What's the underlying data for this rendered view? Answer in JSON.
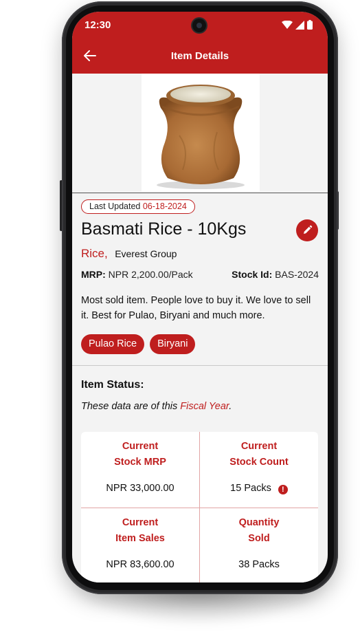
{
  "status_bar": {
    "time": "12:30",
    "icons": [
      "wifi-icon",
      "signal-icon",
      "battery-icon"
    ]
  },
  "app_bar": {
    "title": "Item Details",
    "back_icon": "arrow-left-icon"
  },
  "item": {
    "last_updated_label": "Last Updated",
    "last_updated_date": "06-18-2024",
    "name": "Basmati Rice - 10Kgs",
    "category": "Rice,",
    "brand": "Everest Group",
    "mrp_label": "MRP:",
    "mrp_value": "NPR 2,200.00/Pack",
    "stock_id_label": "Stock Id:",
    "stock_id_value": "BAS-2024",
    "description": "Most sold item. People love to buy it. We love to sell it. Best for Pulao, Biryani and much more.",
    "tags": [
      "Pulao Rice",
      "Biryani"
    ],
    "edit_icon": "pencil-icon"
  },
  "item_status": {
    "title": "Item Status:",
    "note_prefix": "These data are of this ",
    "note_highlight": "Fiscal Year",
    "note_suffix": ".",
    "cells": [
      {
        "label_line1": "Current",
        "label_line2": "Stock MRP",
        "value": "NPR 33,000.00"
      },
      {
        "label_line1": "Current",
        "label_line2": "Stock Count",
        "value": "15 Packs"
      },
      {
        "label_line1": "Current",
        "label_line2": "Item Sales",
        "value": "NPR 83,600.00"
      },
      {
        "label_line1": "Quantity",
        "label_line2": "Sold",
        "value": "38 Packs"
      }
    ],
    "alert_icon": "exclamation-circle-icon",
    "alert_symbol": "!"
  },
  "colors": {
    "primary": "#bf1e1e",
    "background": "#f3f3f3",
    "divider": "#e2a4a4"
  }
}
